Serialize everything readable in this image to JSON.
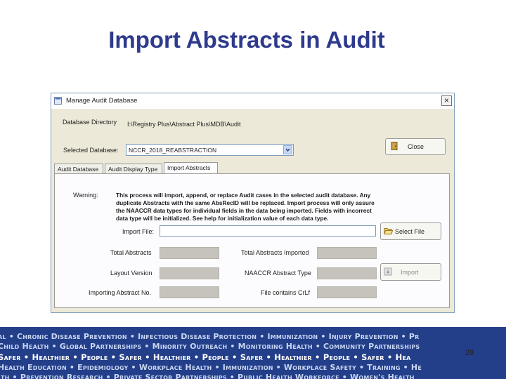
{
  "slide": {
    "title": "Import Abstracts in Audit",
    "page_number": "28"
  },
  "window": {
    "title": "Manage Audit Database",
    "close_glyph": "×",
    "database_directory_label": "Database Directory",
    "database_directory_value": "I:\\Registry Plus\\Abstract Plus\\MDB\\Audit",
    "selected_database_label": "Selected Database:",
    "selected_database_value": "NCCR_2018_REABSTRACTION",
    "close_button_label": "Close",
    "tabs": [
      {
        "label": "Audit Database"
      },
      {
        "label": "Audit Display Type"
      },
      {
        "label": "Import Abstracts"
      }
    ],
    "active_tab": "Import Abstracts",
    "warning_label": "Warning:",
    "warning_lines": [
      "This process will import, append, or replace Audit cases in the selected audit database.  Any",
      "duplicate Abstracts with the same AbsRecID will be replaced.  Import process will only assure",
      "the NAACCR data types for individual fields in the data being imported.  Fields with incorrect",
      "data type will be initialized.  See help for initialization value of each data type."
    ],
    "import_file_label": "Import File:",
    "import_file_value": "",
    "select_file_button_label": "Select File",
    "total_abstracts_label": "Total Abstracts",
    "total_abstracts_imported_label": "Total Abstracts Imported",
    "layout_version_label": "Layout Version",
    "naaccr_abstract_type_label": "NAACCR Abstract Type",
    "importing_abstract_no_label": "Importing Abstract No.",
    "file_contains_crlf_label": "File contains CrLf",
    "import_button_label": "Import"
  },
  "footer": {
    "lines": [
      "al • Chronic Disease Prevention • Infectious Disease Protection • Immunization • Injury Prevention • Pr",
      "Child Health • Global Partnerships • Minority Outreach • Monitoring Health • Community Partnerships",
      "Safer • Healthier • People • Safer • Healthier • People • Safer • Healthier • People • Safer • Hea",
      "Health Education • Epidemiology • Workplace Health • Immunization • Workplace Safety • Training • He",
      "lth • Prevention Research • Private Sector Partnerships • Public Health Workforce • Women's Health"
    ]
  },
  "colors": {
    "title": "#2e3a8c",
    "footer_background": "#233f8a",
    "window_background": "#ece9d8",
    "readonly_field": "#c6c3bc"
  },
  "icons": [
    "app-window-icon",
    "close-x-icon",
    "dropdown-arrow-icon",
    "close-door-icon",
    "folder-open-icon",
    "import-icon"
  ]
}
